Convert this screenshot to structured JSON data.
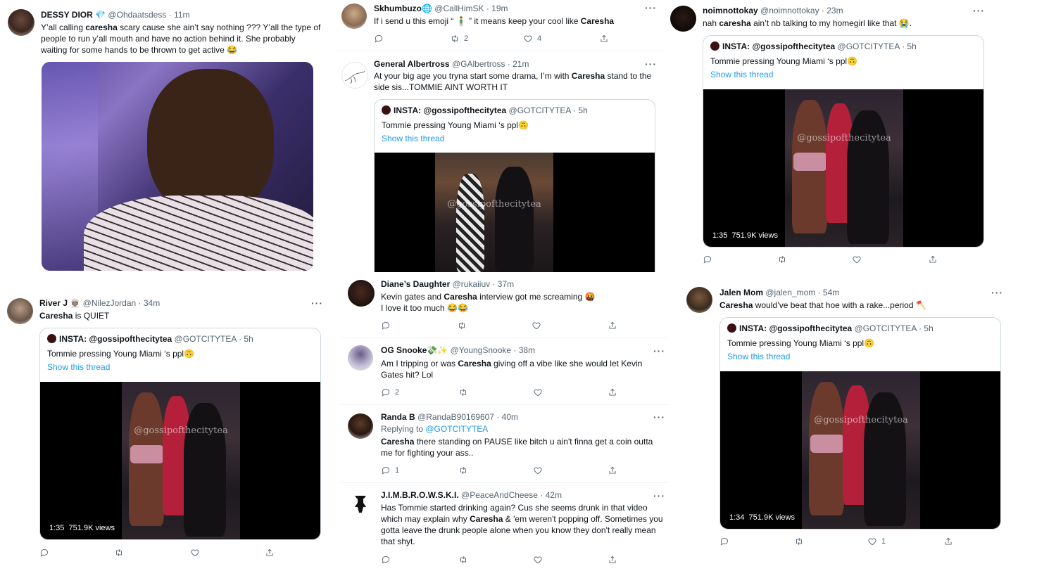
{
  "colors": {
    "link": "#1d9bf0",
    "meta": "#536471",
    "border": "#cfd9de"
  },
  "quote_common": {
    "name": "INSTA: @gossipofthecitytea",
    "handle": "@GOTCITYTEA",
    "time": "· 5h",
    "text": "Tommie pressing Young Miami ‘s ppl🙃",
    "show_thread": "Show this thread",
    "watermark": "@gossipofthecitytea"
  },
  "tweets": {
    "dessy": {
      "name": "DESSY DIOR 💎",
      "handle": "@Ohdaatsdess",
      "time": "· 11m",
      "t1": "Y’all calling ",
      "b1": "caresha",
      "t2": " scary cause she ain’t say nothing ??? Y’all the type of people to run y’all mouth and have no action behind it. She probably waiting for some hands to be thrown to get active 😂"
    },
    "skhumbuzo": {
      "name": "Skhumbuzo🌐",
      "handle": "@CallHimSK",
      "time": "· 19m",
      "t1": "If i send u this emoji “ 🧍‍♂️ ” it means keep your cool like ",
      "b1": "Caresha",
      "retweets": "2",
      "likes": "4"
    },
    "general": {
      "name": "General Albertross",
      "handle": "@GAlbertross",
      "time": "· 21m",
      "t1": "At your big age you tryna start some drama, I’m with ",
      "b1": "Caresha",
      "t2": " stand to the side sis...TOMMIE AINT WORTH IT"
    },
    "noim": {
      "name": "noimnottokay",
      "handle": "@noimnottokay",
      "time": "· 23m",
      "t1": "nah ",
      "b1": "caresha",
      "t2": " ain’t nb talking to my homegirl like that 😭.",
      "video_time": "1:35",
      "video_views": "751.9K views"
    },
    "river": {
      "name": "River J 👳🏽",
      "handle": "@NilezJordan",
      "time": "· 34m",
      "b1": "Caresha",
      "t2": " is QUIET",
      "video_time": "1:35",
      "video_views": "751.9K views"
    },
    "diane": {
      "name": "Diane’s Daughter",
      "handle": "@rukaiiuv",
      "time": "· 37m",
      "t1": "Kevin gates and ",
      "b1": "Caresha",
      "t2": " interview got me screaming 🤬",
      "line2": " I love it too much 😂😂"
    },
    "ogsnooke": {
      "name": "OG Snooke💸✨",
      "handle": "@YoungSnooke",
      "time": "· 38m",
      "t1": "Am I tripping or was ",
      "b1": "Caresha",
      "t2": " giving off a vibe like she would let Kevin Gates hit? Lol",
      "replies": "2"
    },
    "randab": {
      "name": "Randa B",
      "handle": "@RandaB90169607",
      "time": "· 40m",
      "replying_prefix": "Replying to ",
      "replying_to": "@GOTCITYTEA",
      "b1": "Caresha",
      "t2": " there standing on PAUSE like bitch u ain't finna get a coin outta me for fighting your ass..",
      "replies": "1"
    },
    "jimbrowski": {
      "name": "J.I.M.B.R.O.W.S.K.I.",
      "handle": "@PeaceAndCheese",
      "time": "· 42m",
      "t1": "Has Tommie started drinking again? Cus she seems drunk in that video which may explain why ",
      "b1": "Caresha",
      "t2": " & 'em weren't popping off. Sometimes you gotta leave the drunk people alone when you know they don't really mean that shyt."
    },
    "jalen": {
      "name": "Jalen Mom",
      "handle": "@jalen_mom",
      "time": "· 54m",
      "b1": "Caresha",
      "t2": " would’ve beat that hoe with a rake...period 🪓",
      "video_time": "1:34",
      "video_views": "751.9K views",
      "likes": "1"
    }
  },
  "icons": [
    "reply-icon",
    "retweet-icon",
    "like-icon",
    "share-icon",
    "more-icon"
  ]
}
